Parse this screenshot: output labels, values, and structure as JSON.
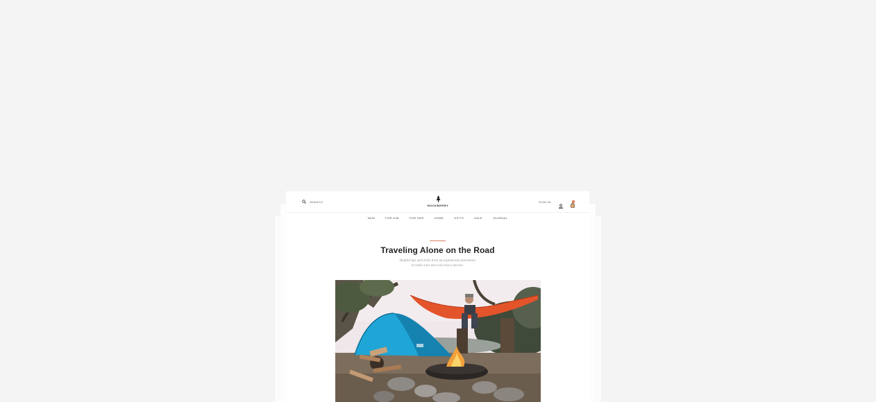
{
  "header": {
    "search_label": "SEARCH",
    "logo_text": "HUCKBERRY",
    "signin_label": "SIGN IN",
    "cart_count": "0"
  },
  "nav": {
    "items": [
      "NEW",
      "FOR HIM",
      "FOR HER",
      "HOME",
      "GIFTS",
      "SALE",
      "JOURNAL"
    ]
  },
  "article": {
    "title": "Traveling Alone on the Road",
    "subtitle_line1": "Helpful tips and tricks from an experienced adventurer",
    "subtitle_line2": "to make your next solo trip a success."
  },
  "icons": {
    "search": "search-icon",
    "logo": "tree-logo-icon",
    "user": "user-icon",
    "cart": "cart-icon"
  },
  "colors": {
    "background": "#f4f4f4",
    "accent": "#d77d63",
    "cart_badge": "#d35e2f",
    "title": "#222222"
  }
}
